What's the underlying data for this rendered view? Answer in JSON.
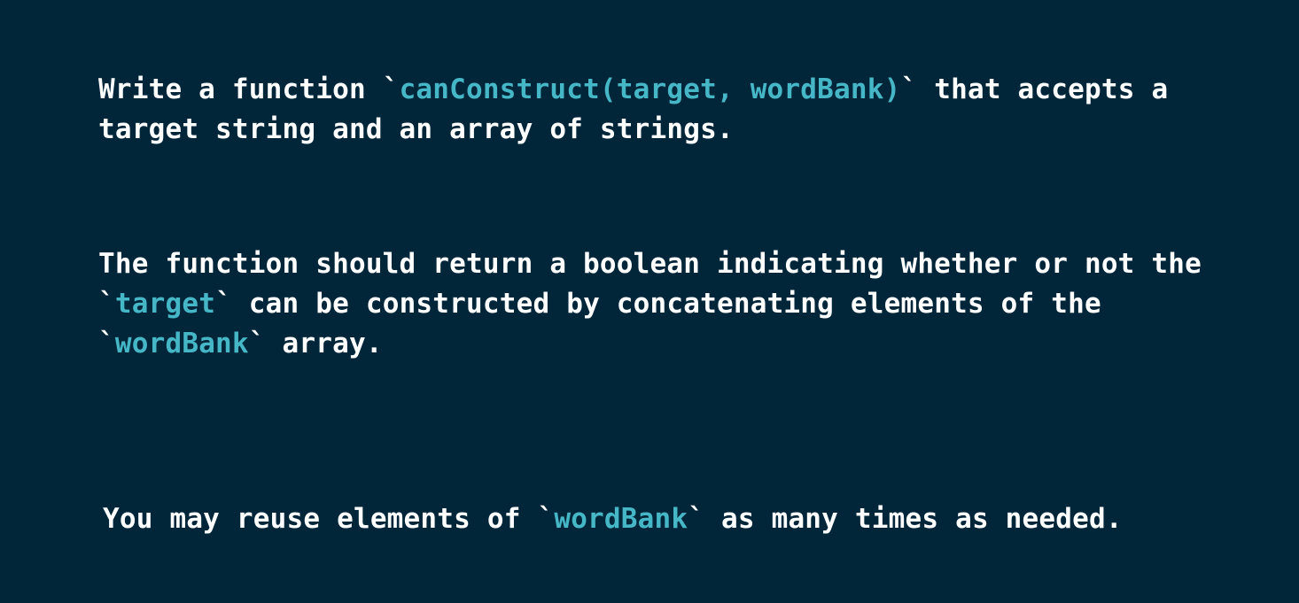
{
  "colors": {
    "background": "#01263a",
    "text": "#ffffff",
    "code": "#46b7c6"
  },
  "p1": {
    "line1_before": "Write a function ",
    "line1_code": "canConstruct(target, wordBank)",
    "line1_after": " that accepts a",
    "line2": "target string and an array of strings."
  },
  "p2": {
    "line1": "The function should return a boolean indicating whether or not the",
    "line2_code": "target",
    "line2_after": " can be constructed by concatenating elements of the",
    "line3_code": "wordBank",
    "line3_after": " array."
  },
  "p3": {
    "before": "You may reuse elements of ",
    "code": "wordBank",
    "after": " as many times as needed."
  }
}
